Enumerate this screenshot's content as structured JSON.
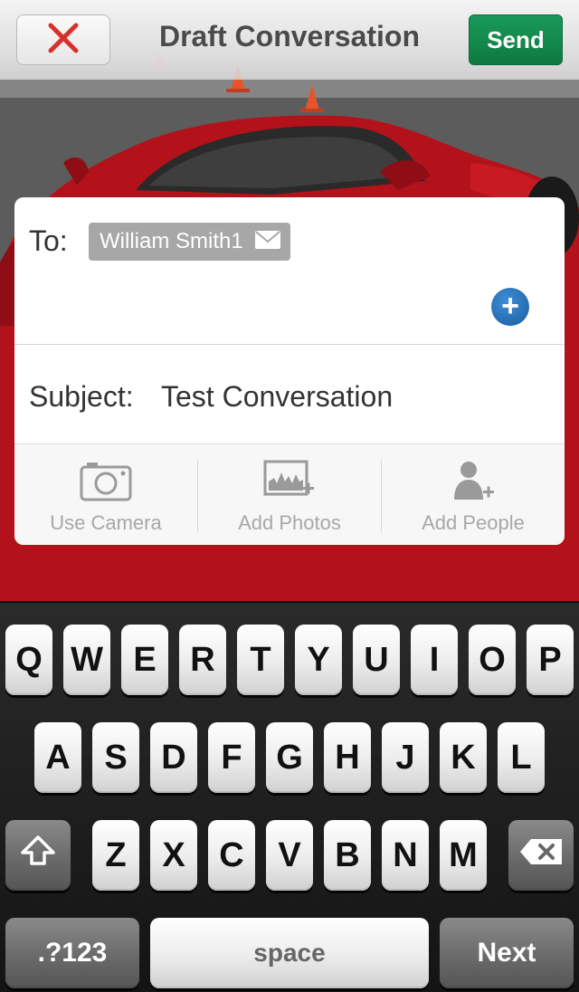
{
  "header": {
    "title": "Draft Conversation",
    "close_icon": "close-x-icon",
    "send_label": "Send"
  },
  "compose": {
    "to_label": "To:",
    "recipient": "William Smith1",
    "recipient_icon": "envelope-icon",
    "add_recipient_icon": "plus-icon",
    "subject_label": "Subject:",
    "subject_value": "Test Conversation"
  },
  "actions": [
    {
      "label": "Use Camera",
      "icon": "camera-icon"
    },
    {
      "label": "Add Photos",
      "icon": "add-photo-icon"
    },
    {
      "label": "Add People",
      "icon": "add-person-icon"
    }
  ],
  "keyboard": {
    "row1": [
      "Q",
      "W",
      "E",
      "R",
      "T",
      "Y",
      "U",
      "I",
      "O",
      "P"
    ],
    "row2": [
      "A",
      "S",
      "D",
      "F",
      "G",
      "H",
      "J",
      "K",
      "L"
    ],
    "row3": [
      "Z",
      "X",
      "C",
      "V",
      "B",
      "N",
      "M"
    ],
    "mode_label": ".?123",
    "space_label": "space",
    "next_label": "Next",
    "shift_icon": "shift-icon",
    "backspace_icon": "backspace-icon"
  },
  "colors": {
    "send_green": "#12884c",
    "close_red": "#d8302a",
    "add_blue": "#1f68ad"
  }
}
